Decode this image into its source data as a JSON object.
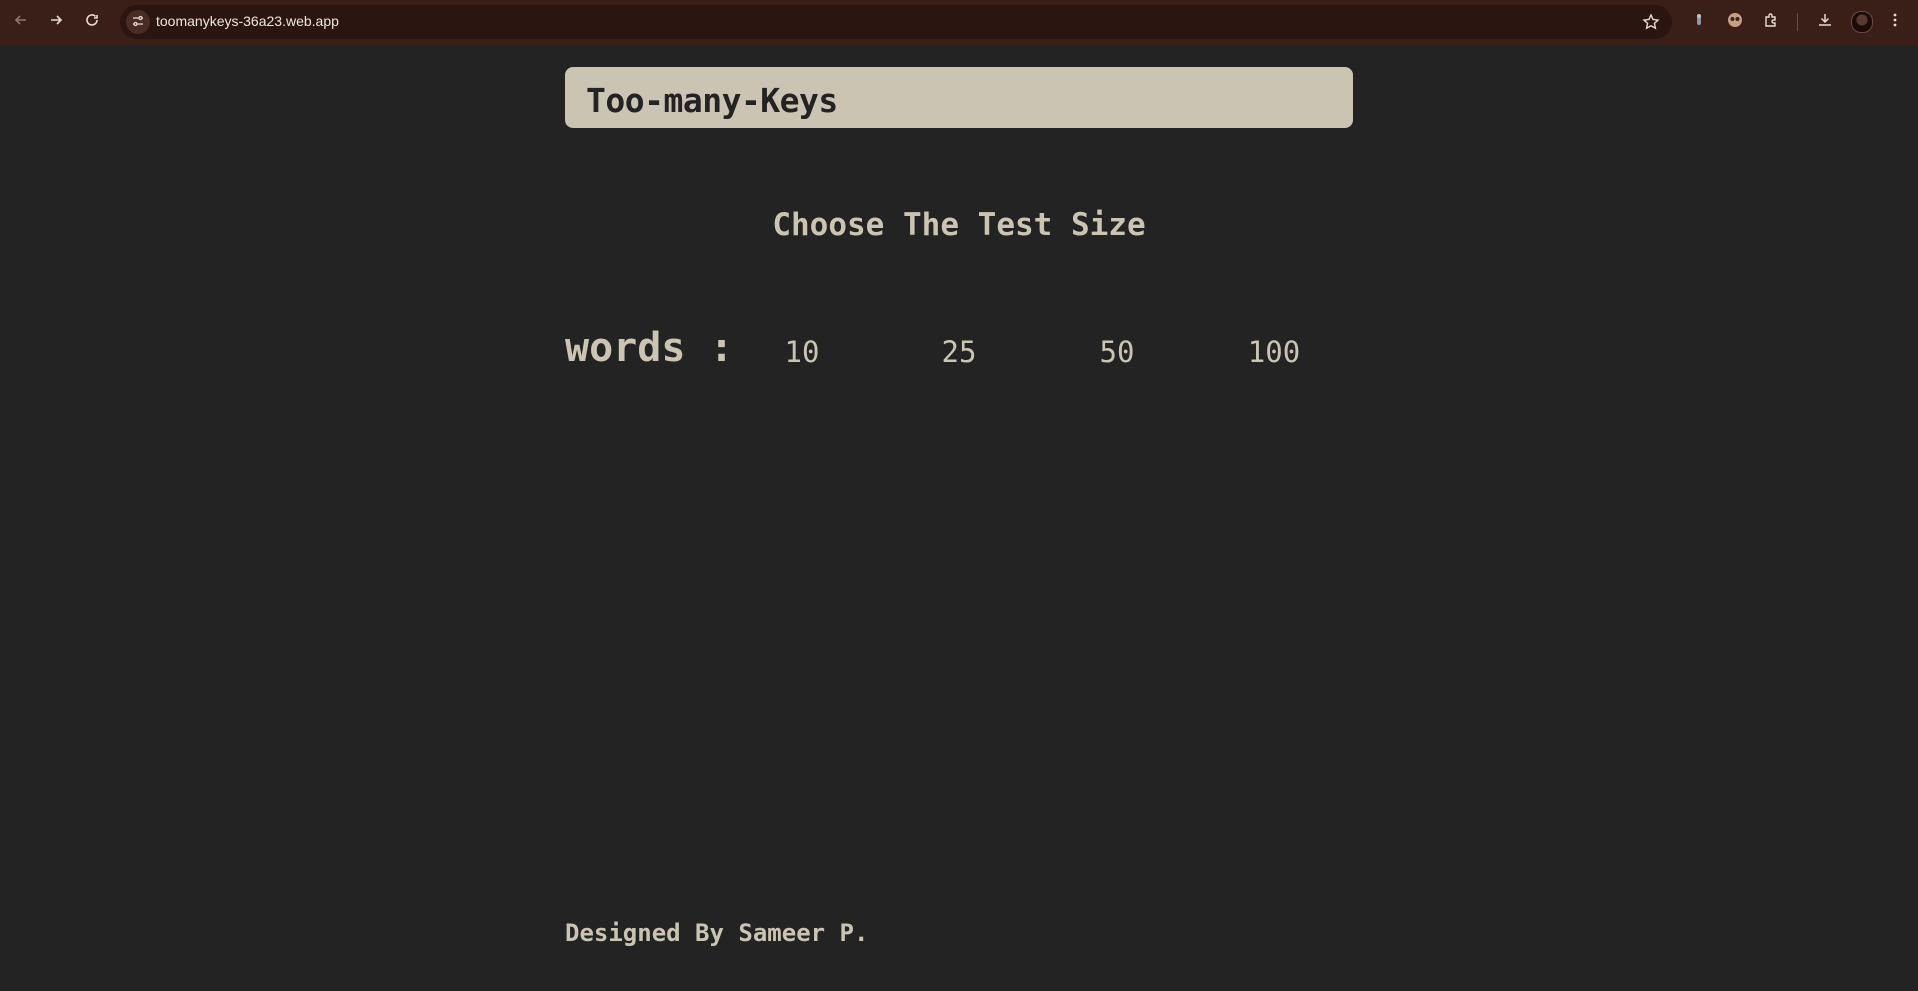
{
  "browser": {
    "url": "toomanykeys-36a23.web.app",
    "back_icon": "arrow-left-icon",
    "forward_icon": "arrow-right-icon",
    "reload_icon": "reload-icon",
    "bookmark_icon": "star-icon",
    "colors": {
      "toolbar": "#3a1f18",
      "omnibox": "#2b1510"
    }
  },
  "page": {
    "logo": "Too-many-Keys",
    "heading": "Choose The Test Size",
    "words_label": "words :",
    "options": [
      "10",
      "25",
      "50",
      "100"
    ],
    "footer": "Designed By Sameer P.",
    "colors": {
      "background": "#232323",
      "accent": "#ccc4b3"
    }
  }
}
